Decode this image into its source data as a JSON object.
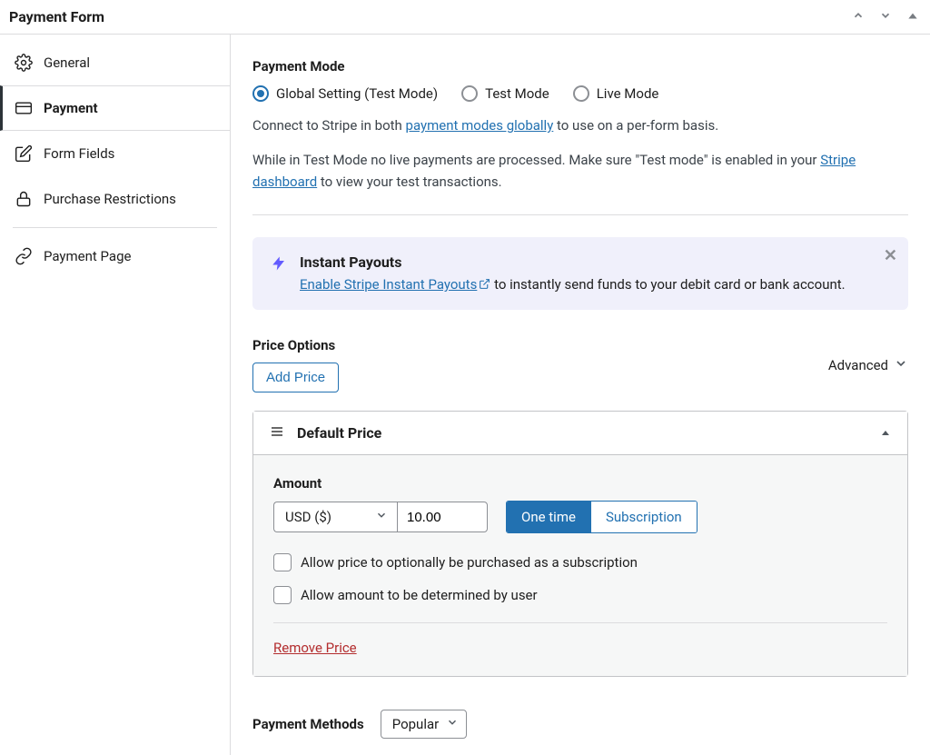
{
  "header": {
    "title": "Payment Form"
  },
  "sidebar": {
    "items": [
      {
        "label": "General"
      },
      {
        "label": "Payment"
      },
      {
        "label": "Form Fields"
      },
      {
        "label": "Purchase Restrictions"
      },
      {
        "label": "Payment Page"
      }
    ]
  },
  "payment_mode": {
    "label": "Payment Mode",
    "options": {
      "global": "Global Setting (Test Mode)",
      "test": "Test Mode",
      "live": "Live Mode"
    },
    "help_prefix": "Connect to Stripe in both ",
    "help_link": "payment modes globally",
    "help_suffix": " to use on a per-form basis.",
    "note_prefix": "While in Test Mode no live payments are processed. Make sure \"Test mode\" is enabled in your ",
    "note_link": "Stripe dashboard",
    "note_suffix": " to view your test transactions."
  },
  "instant_payouts": {
    "title": "Instant Payouts",
    "link_text": "Enable Stripe Instant Payouts",
    "suffix": " to instantly send funds to your debit card or bank account."
  },
  "price_options": {
    "label": "Price Options",
    "add_button": "Add Price",
    "advanced_label": "Advanced"
  },
  "default_price": {
    "title": "Default Price",
    "amount_label": "Amount",
    "currency_display": "USD ($)",
    "amount_value": "10.00",
    "one_time": "One time",
    "subscription": "Subscription",
    "allow_subscription": "Allow price to optionally be purchased as a subscription",
    "allow_user_amount": "Allow amount to be determined by user",
    "remove": "Remove Price"
  },
  "payment_methods": {
    "label": "Payment Methods",
    "selected": "Popular"
  }
}
